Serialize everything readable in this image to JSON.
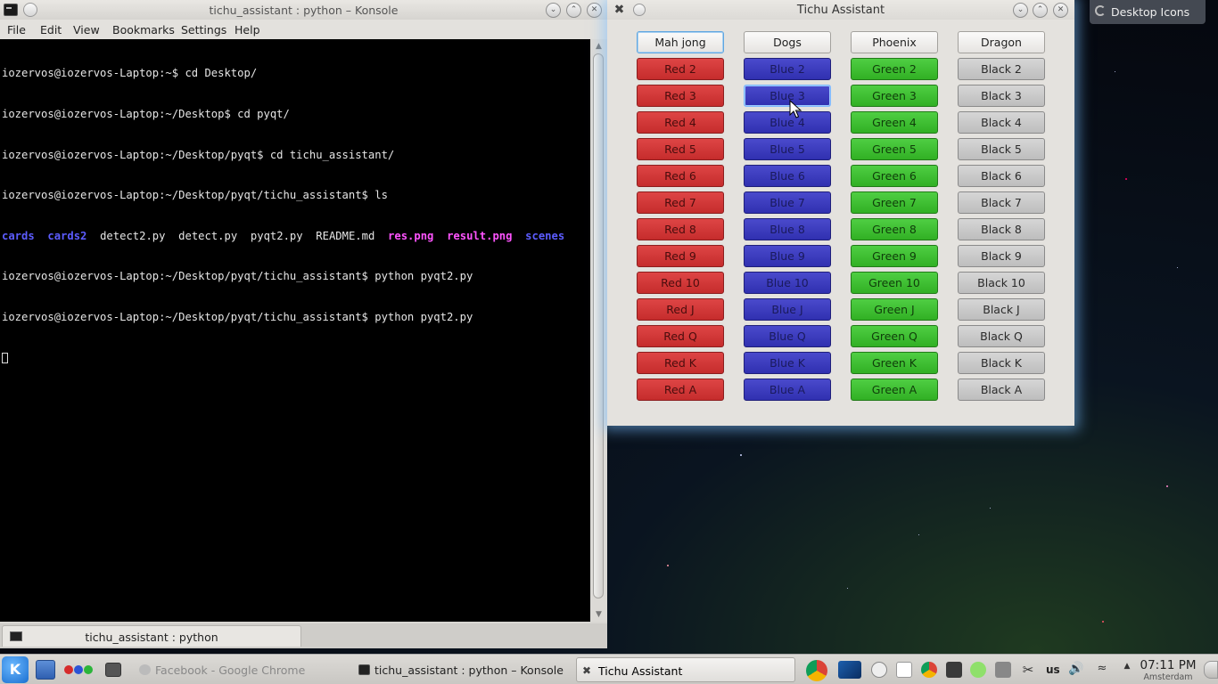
{
  "konsole": {
    "title": "tichu_assistant : python – Konsole",
    "menu": [
      "File",
      "Edit",
      "View",
      "Bookmarks",
      "Settings",
      "Help"
    ],
    "terminal_lines": [
      "iozervos@iozervos-Laptop:~$ cd Desktop/",
      "iozervos@iozervos-Laptop:~/Desktop$ cd pyqt/",
      "iozervos@iozervos-Laptop:~/Desktop/pyqt$ cd tichu_assistant/",
      "iozervos@iozervos-Laptop:~/Desktop/pyqt/tichu_assistant$ ls"
    ],
    "ls_output": {
      "cards": "cards",
      "cards2": "cards2",
      "detect2": "detect2.py",
      "detect": "detect.py",
      "pyqt2": "pyqt2.py",
      "readme": "README.md",
      "res": "res.png",
      "result": "result.png",
      "scenes": "scenes"
    },
    "terminal_lines_after": [
      "iozervos@iozervos-Laptop:~/Desktop/pyqt/tichu_assistant$ python pyqt2.py",
      "iozervos@iozervos-Laptop:~/Desktop/pyqt/tichu_assistant$ python pyqt2.py"
    ],
    "tab_label": "tichu_assistant : python"
  },
  "tichu": {
    "title": "Tichu Assistant",
    "columns": [
      {
        "color": "special",
        "cards": [
          "Mah jong"
        ]
      },
      {
        "color": "special",
        "cards": [
          "Dogs"
        ]
      },
      {
        "color": "special",
        "cards": [
          "Phoenix"
        ]
      },
      {
        "color": "special",
        "cards": [
          "Dragon"
        ]
      }
    ],
    "specials": [
      "Mah jong",
      "Dogs",
      "Phoenix",
      "Dragon"
    ],
    "suits": [
      {
        "class": "red",
        "name": "Red"
      },
      {
        "class": "blue",
        "name": "Blue"
      },
      {
        "class": "green",
        "name": "Green"
      },
      {
        "class": "black",
        "name": "Black"
      }
    ],
    "ranks": [
      "2",
      "3",
      "4",
      "5",
      "6",
      "7",
      "8",
      "9",
      "10",
      "J",
      "Q",
      "K",
      "A"
    ],
    "colors": {
      "red": "#d23a3a",
      "blue": "#3c3cc0",
      "green": "#3cbf30",
      "black": "#c9c9c9"
    }
  },
  "desktop_widget": {
    "label": "Desktop Icons"
  },
  "taskbar": {
    "tasks": [
      {
        "label": "Facebook - Google Chrome",
        "state": "inactive"
      },
      {
        "label": "tichu_assistant : python – Konsole",
        "state": "normal"
      },
      {
        "label": "Tichu Assistant",
        "state": "active"
      }
    ],
    "keyboard_layout": "us",
    "clock_time": "07:11 PM",
    "clock_city": "Amsterdam"
  }
}
